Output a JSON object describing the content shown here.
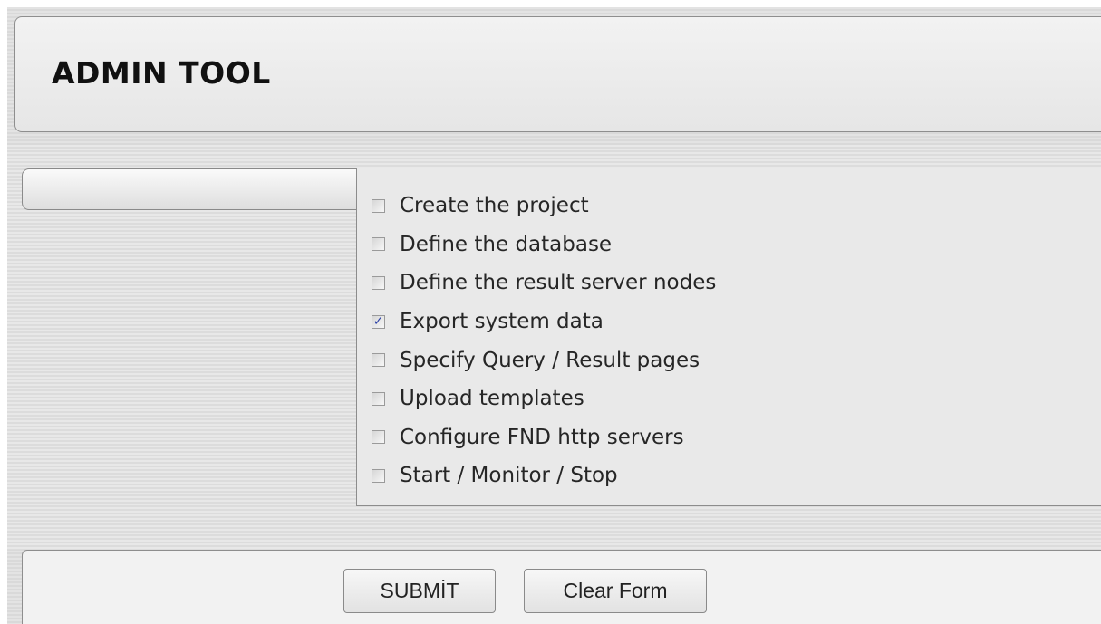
{
  "header": {
    "title": "ADMIN TOOL"
  },
  "tasks": {
    "items": [
      {
        "label": "Create the project",
        "checked": false
      },
      {
        "label": "Define the database",
        "checked": false
      },
      {
        "label": "Define the result server nodes",
        "checked": false
      },
      {
        "label": "Export system data",
        "checked": true
      },
      {
        "label": "Specify Query / Result pages",
        "checked": false
      },
      {
        "label": "Upload templates",
        "checked": false
      },
      {
        "label": "Configure FND http servers",
        "checked": false
      },
      {
        "label": "Start / Monitor / Stop",
        "checked": false
      }
    ]
  },
  "footer": {
    "submit_label": "SUBMİT",
    "clear_label": "Clear Form"
  },
  "colors": {
    "check_mark": "#2f43a8",
    "panel_border": "#8c8c8c"
  }
}
